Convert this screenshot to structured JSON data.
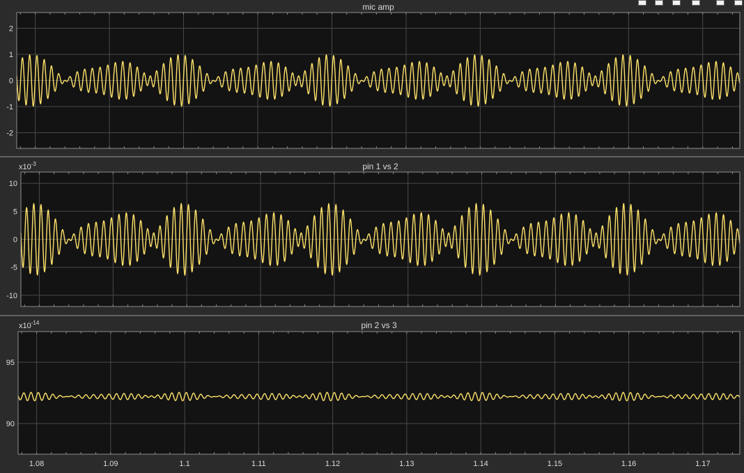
{
  "colors": {
    "background": "#2b2b2b",
    "axes_bg": "#131313",
    "grid": "#4a4a4a",
    "trace": "#ffe36b",
    "text": "#dcdcdc",
    "frame": "#8c8c8c"
  },
  "toolbar": {
    "icons": [
      "zoom-icon",
      "pan-icon",
      "cursor-icon",
      "fit-icon",
      "settings-icon",
      "undock-icon"
    ]
  },
  "chart_data": [
    {
      "type": "line",
      "title": "mic amp",
      "exponent": "",
      "xlim": [
        1.0775,
        1.175
      ],
      "ylim": [
        -2.6,
        2.6
      ],
      "yticks": [
        -2,
        -1,
        0,
        1,
        2
      ],
      "yticklabels": [
        "-2",
        "-1",
        "0",
        "1",
        "2"
      ],
      "grid": true,
      "signal": {
        "carrier_hz": 1000,
        "envelope_hz": 100,
        "amplitude": 1.0,
        "offset": 0
      }
    },
    {
      "type": "line",
      "title": "pin 1 vs 2",
      "exponent": "-3",
      "xlim": [
        1.0775,
        1.175
      ],
      "ylim": [
        -12,
        12
      ],
      "yticks": [
        -10,
        -5,
        0,
        5,
        10
      ],
      "yticklabels": [
        "-10",
        "-5",
        "0",
        "5",
        "10"
      ],
      "grid": true,
      "signal": {
        "carrier_hz": 1000,
        "envelope_hz": 100,
        "amplitude": 6.5,
        "offset": 0
      }
    },
    {
      "type": "line",
      "title": "pin 2 vs 3",
      "exponent": "-14",
      "xlim": [
        1.0775,
        1.175
      ],
      "ylim": [
        87.5,
        97.5
      ],
      "yticks": [
        90,
        95
      ],
      "yticklabels": [
        "90",
        "95"
      ],
      "grid": true,
      "signal": {
        "carrier_hz": 1000,
        "envelope_hz": 100,
        "amplitude": 0.35,
        "offset": 92.2
      }
    }
  ],
  "xaxis": {
    "ticks": [
      1.08,
      1.09,
      1.1,
      1.11,
      1.12,
      1.13,
      1.14,
      1.15,
      1.16,
      1.17
    ],
    "ticklabels": [
      "1.08",
      "1.09",
      "1.1",
      "1.11",
      "1.12",
      "1.13",
      "1.14",
      "1.15",
      "1.16",
      "1.17"
    ]
  }
}
